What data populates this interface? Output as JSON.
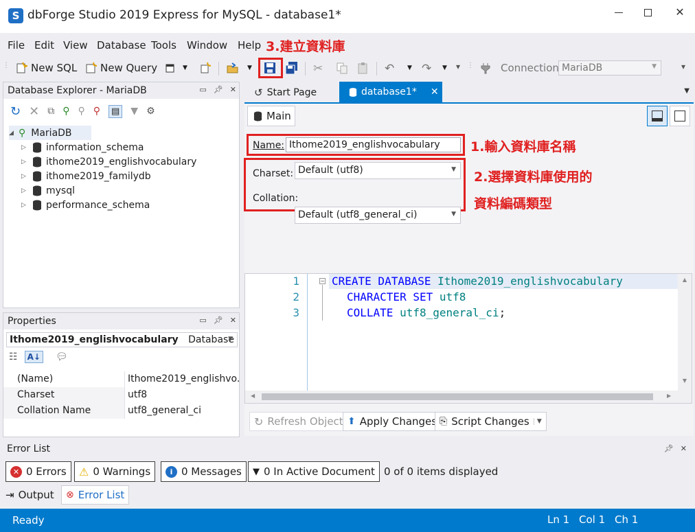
{
  "window": {
    "title": "dbForge Studio 2019 Express for MySQL - database1*"
  },
  "menu": {
    "items": [
      "File",
      "Edit",
      "View",
      "Database",
      "Tools",
      "Window",
      "Help"
    ]
  },
  "annotations": {
    "save": "3.建立資料庫",
    "name": "1.輸入資料庫名稱",
    "charset_line1": "2.選擇資料庫使用的",
    "charset_line2": "資料編碼類型"
  },
  "toolbar": {
    "new_sql": "New SQL",
    "new_query": "New Query",
    "connection_label": "Connection",
    "connection_value": "MariaDB"
  },
  "db_explorer": {
    "title": "Database Explorer - MariaDB",
    "root": "MariaDB",
    "databases": [
      "information_schema",
      "ithome2019_englishvocabulary",
      "ithome2019_familydb",
      "mysql",
      "performance_schema"
    ]
  },
  "properties": {
    "title": "Properties",
    "object_name": "Ithome2019_englishvocabulary",
    "object_type": "Database",
    "rows": [
      {
        "key": "(Name)",
        "value": "Ithome2019_englishvo..."
      },
      {
        "key": "Charset",
        "value": "utf8"
      },
      {
        "key": "Collation Name",
        "value": "utf8_general_ci"
      }
    ]
  },
  "tabs": {
    "start": "Start Page",
    "active": "database1*"
  },
  "editor": {
    "main_label": "Main",
    "name_label": "Name:",
    "name_value": "Ithome2019_englishvocabulary",
    "charset_label": "Charset:",
    "charset_value": "Default (utf8)",
    "collation_label": "Collation:",
    "collation_value": "Default (utf8_general_ci)",
    "line_numbers": [
      "1",
      "2",
      "3"
    ],
    "code": {
      "l1_kw": "CREATE DATABASE",
      "l1_id": "Ithome2019_englishvocabulary",
      "l2_kw": "CHARACTER SET",
      "l2_id": "utf8",
      "l3_kw": "COLLATE",
      "l3_id": "utf8_general_ci",
      "l3_end": ";"
    },
    "refresh": "Refresh Object",
    "apply": "Apply Changes",
    "script": "Script Changes"
  },
  "error_list": {
    "title": "Error List",
    "errors": "0 Errors",
    "warnings": "0 Warnings",
    "messages": "0 Messages",
    "active_doc": "0 In Active Document",
    "summary": "0 of 0 items displayed",
    "tab_output": "Output",
    "tab_errorlist": "Error List"
  },
  "status": {
    "ready": "Ready",
    "ln": "Ln 1",
    "col": "Col 1",
    "ch": "Ch 1"
  },
  "colors": {
    "accent": "#007acc",
    "annotation": "#e02020",
    "keyword": "#0000ff",
    "identifier": "#008080"
  }
}
